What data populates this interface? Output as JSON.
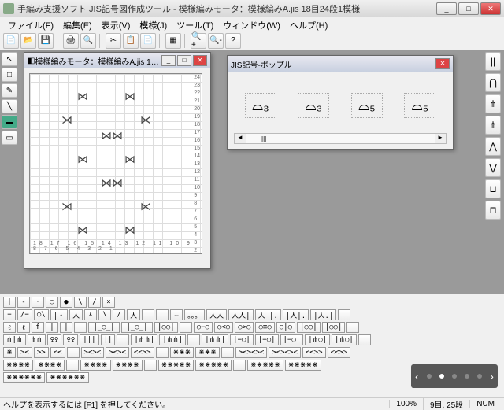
{
  "title": "手編み支援ソフト JIS記号図作成ツール - 模様編みモータ：模様編みA.jis 18目24段1模様",
  "menu": [
    "ファイル(F)",
    "編集(E)",
    "表示(V)",
    "模様(J)",
    "ツール(T)",
    "ウィンドウ(W)",
    "ヘルプ(H)"
  ],
  "editor_title": "模様編みモータ：模様編みA.jis 18目...",
  "popup_title": "JIS記号-ポップル",
  "rows_right": "24\n23\n22\n21\n20\n19\n18\n17\n16\n15\n14\n13\n12\n11\n10\n9\n8\n7\n6\n5\n4\n3\n2\n1",
  "rows_bottom": "18 17 16 15 14 13 12 11 10 9 8 7 6 5 4 3 2 1",
  "status_help": "ヘルプを表示するには [F1] を押してください。",
  "status_zoom": "100%",
  "status_pos": "9目, 25段",
  "status_num": "NUM",
  "sym_rows": [
    [
      "|",
      "-",
      "·",
      "○",
      "●",
      "\\",
      "/",
      "×"
    ],
    [
      "−",
      "/−",
      "○\\",
      "|・",
      "人",
      "⋏",
      "\\",
      "/",
      "人",
      " ",
      " ",
      "…",
      "。。。",
      "人人",
      "人人|",
      "人 |.",
      "|人|.",
      "|人.|",
      " "
    ],
    [
      "ℓ",
      "ℓ",
      "f",
      "|",
      "|",
      " ",
      "|_○_|",
      "|_○_|",
      "|○○|",
      " ",
      "○−○",
      "○<○",
      "○>○",
      "○≡○",
      "○|○",
      "|○○|",
      "|○○|",
      " "
    ],
    [
      "⋔|⋔",
      "⋔⋔",
      "♀♀",
      "♀♀",
      "|||",
      "||",
      " ",
      "|⋔⋔|",
      "|⋔⋔|",
      " ",
      "|⋔⋔|",
      "|−○|",
      "|−○|",
      "|−○|",
      "|⋔○|",
      "|⋔○|",
      " "
    ],
    [
      "⋇",
      "><",
      ">>",
      "<<",
      " ",
      "><><",
      "><><",
      "<<>>",
      " ",
      "⋇⋇⋇",
      "⋇⋇⋇",
      " ",
      "><><><",
      "><><><",
      "<<>>",
      "<<>>"
    ],
    [
      "⋇⋇⋇⋇",
      "⋇⋇⋇⋇",
      " ",
      "⋇⋇⋇⋇",
      "⋇⋇⋇⋇",
      " ",
      "⋇⋇⋇⋇⋇",
      "⋇⋇⋇⋇⋇",
      " ",
      "⋇⋇⋇⋇⋇",
      "⋇⋇⋇⋇⋇"
    ],
    [
      "⋇⋇⋇⋇⋇⋇",
      "⋇⋇⋇⋇⋇⋇"
    ]
  ]
}
